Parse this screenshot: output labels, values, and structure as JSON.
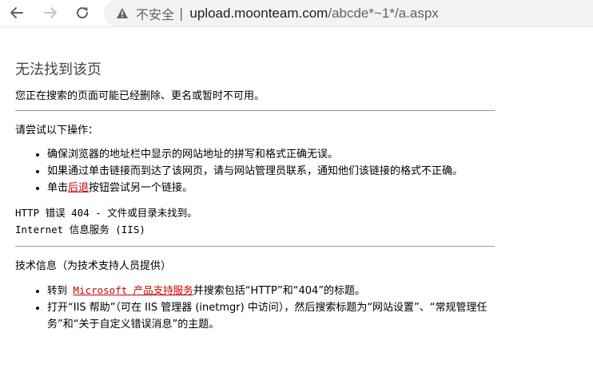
{
  "browser": {
    "security_label": "不安全",
    "separator": "|",
    "url_host": "upload.moonteam.com",
    "url_path": "/abcde*~1*/a.aspx"
  },
  "page": {
    "title": "无法找到该页",
    "subtitle": "您正在搜索的页面可能已经删除、更名或暂时不可用。",
    "try_heading": "请尝试以下操作：",
    "try_items": [
      "确保浏览器的地址栏中显示的网站地址的拼写和格式正确无误。",
      "如果通过单击链接而到达了该网页，请与网站管理员联系，通知他们该链接的格式不正确。"
    ],
    "back_item": {
      "prefix": "单击",
      "link": "后退",
      "suffix": "按钮尝试另一个链接。"
    },
    "http_error": "HTTP 错误 404 - 文件或目录未找到。",
    "iis_label": "Internet 信息服务 (IIS)",
    "tech_heading": "技术信息（为技术支持人员提供）",
    "tech_item1": {
      "prefix": "转到 ",
      "link": "Microsoft 产品支持服务",
      "suffix": "并搜索包括“HTTP”和“404”的标题。"
    },
    "tech_item2": "打开“IIS 帮助”（可在 IIS 管理器 (inetmgr) 中访问），然后搜索标题为“网站设置”、“常规管理任务”和“关于自定义错误消息”的主题。"
  },
  "colors": {
    "link": "#cc0000",
    "heading": "#444444",
    "omnibox_bg": "#f1f3f4"
  },
  "icons": [
    "back-arrow-icon",
    "forward-arrow-icon",
    "reload-icon",
    "warning-icon"
  ]
}
